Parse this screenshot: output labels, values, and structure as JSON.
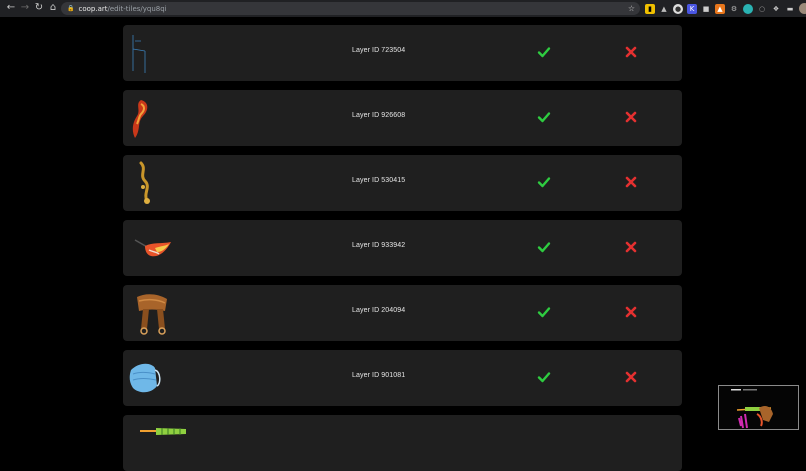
{
  "browser": {
    "url_host": "coop.art",
    "url_path": "/edit-tiles/yqu8qi"
  },
  "rows": [
    {
      "label": "Layer ID 723504",
      "thumb": "blue-sketch-icon"
    },
    {
      "label": "Layer ID 926608",
      "thumb": "flame-tail-icon"
    },
    {
      "label": "Layer ID 530415",
      "thumb": "gold-chain-icon"
    },
    {
      "label": "Layer ID 933942",
      "thumb": "flame-feather-icon"
    },
    {
      "label": "Layer ID 204094",
      "thumb": "saddle-icon"
    },
    {
      "label": "Layer ID 901081",
      "thumb": "face-mask-icon"
    },
    {
      "label": "",
      "thumb": "firework-rocket-icon"
    }
  ],
  "icons": {
    "approve": "check-icon",
    "reject": "cross-icon"
  },
  "colors": {
    "approve": "#2ecc40",
    "reject": "#e53030",
    "row_bg": "#1f1f1f",
    "page_bg": "#000000"
  }
}
